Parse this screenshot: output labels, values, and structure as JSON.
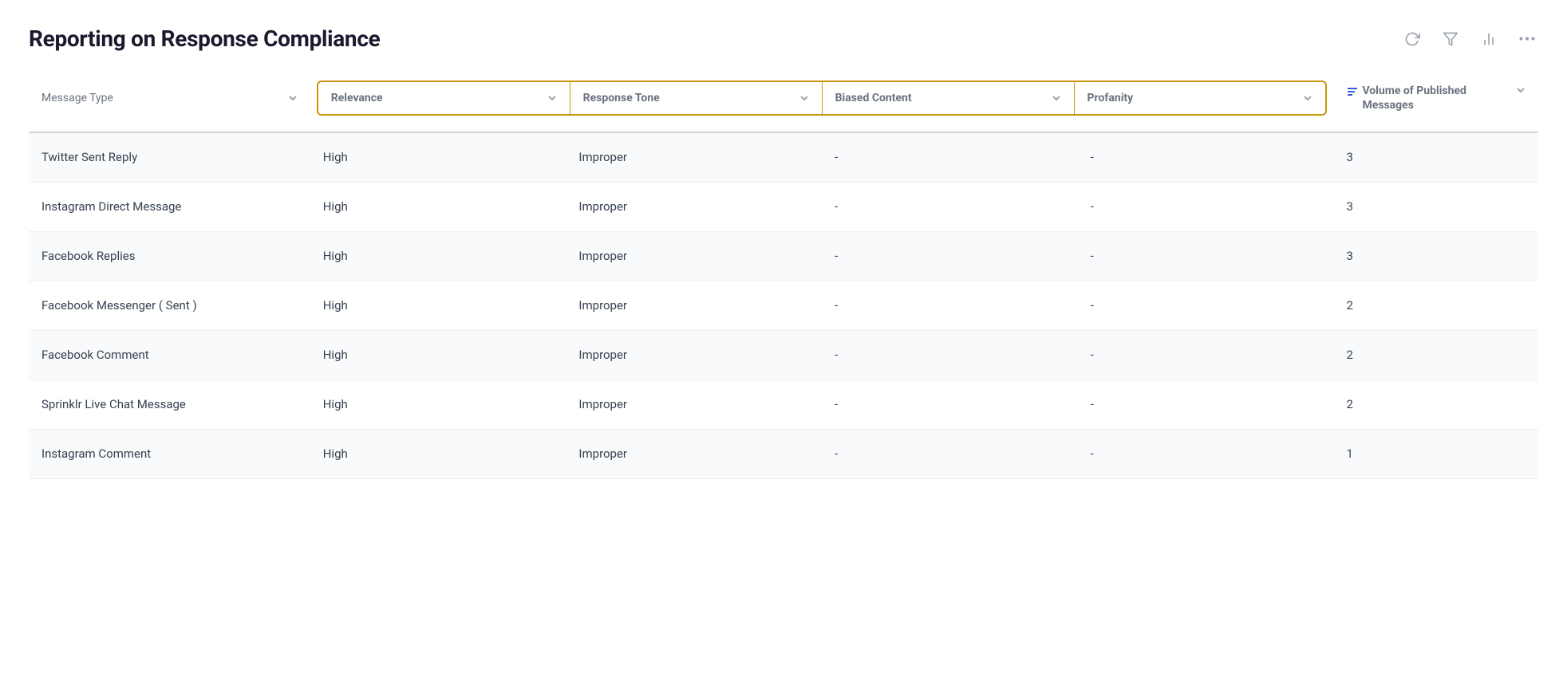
{
  "page": {
    "title": "Reporting on Response Compliance"
  },
  "toolbar": {
    "refresh_icon": "↺",
    "filter_icon": "⊽",
    "chart_icon": "▦",
    "more_icon": "…"
  },
  "table": {
    "columns": [
      {
        "id": "message_type",
        "label": "Message Type",
        "highlighted": false
      },
      {
        "id": "relevance",
        "label": "Relevance",
        "highlighted": true
      },
      {
        "id": "response_tone",
        "label": "Response Tone",
        "highlighted": true
      },
      {
        "id": "biased_content",
        "label": "Biased Content",
        "highlighted": true
      },
      {
        "id": "profanity",
        "label": "Profanity",
        "highlighted": true
      },
      {
        "id": "volume",
        "label": "Volume of Published Messages",
        "highlighted": false,
        "sortActive": true
      }
    ],
    "rows": [
      {
        "message_type": "Twitter Sent Reply",
        "relevance": "High",
        "response_tone": "Improper",
        "biased_content": "-",
        "profanity": "-",
        "volume": "3"
      },
      {
        "message_type": "Instagram Direct Message",
        "relevance": "High",
        "response_tone": "Improper",
        "biased_content": "-",
        "profanity": "-",
        "volume": "3"
      },
      {
        "message_type": "Facebook Replies",
        "relevance": "High",
        "response_tone": "Improper",
        "biased_content": "-",
        "profanity": "-",
        "volume": "3"
      },
      {
        "message_type": "Facebook Messenger ( Sent )",
        "relevance": "High",
        "response_tone": "Improper",
        "biased_content": "-",
        "profanity": "-",
        "volume": "2"
      },
      {
        "message_type": "Facebook Comment",
        "relevance": "High",
        "response_tone": "Improper",
        "biased_content": "-",
        "profanity": "-",
        "volume": "2"
      },
      {
        "message_type": "Sprinklr Live Chat Message",
        "relevance": "High",
        "response_tone": "Improper",
        "biased_content": "-",
        "profanity": "-",
        "volume": "2"
      },
      {
        "message_type": "Instagram Comment",
        "relevance": "High",
        "response_tone": "Improper",
        "biased_content": "-",
        "profanity": "-",
        "volume": "1"
      }
    ]
  }
}
